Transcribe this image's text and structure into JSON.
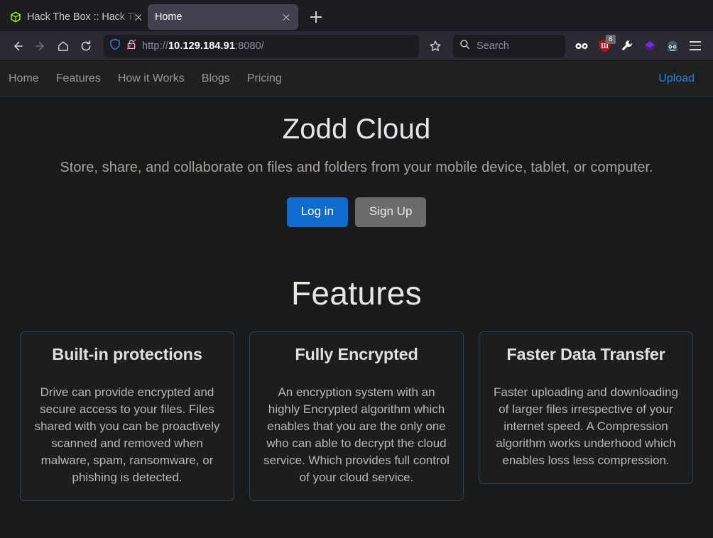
{
  "browser": {
    "tabs": [
      {
        "title": "Hack The Box :: Hack The Box",
        "favicon": "htb-cube-icon",
        "active": false
      },
      {
        "title": "Home",
        "favicon": "none",
        "active": true
      }
    ],
    "new_tab_label": "+",
    "toolbar": {
      "back_icon": "arrow-left-icon",
      "forward_icon": "arrow-right-icon",
      "home_icon": "home-icon",
      "reload_icon": "reload-icon",
      "shield_icon": "shield-icon",
      "lock_icon": "lock-crossed-icon",
      "bookmark_icon": "star-icon",
      "url_scheme": "http://",
      "url_host": "10.129.184.91",
      "url_port_path": ":8080/",
      "url_full": "http://10.129.184.91:8080/"
    },
    "search": {
      "placeholder": "Search",
      "icon": "search-icon"
    },
    "extensions": [
      {
        "name": "infinity-icon",
        "badge": ""
      },
      {
        "name": "ublock-shield-icon",
        "badge": "6"
      },
      {
        "name": "wrench-icon",
        "badge": ""
      },
      {
        "name": "purple-diamond-icon",
        "badge": ""
      },
      {
        "name": "hacker-avatar-icon",
        "badge": ""
      }
    ],
    "menu_icon": "hamburger-menu-icon"
  },
  "site": {
    "nav": {
      "links": [
        {
          "label": "Home"
        },
        {
          "label": "Features"
        },
        {
          "label": "How it Works"
        },
        {
          "label": "Blogs"
        },
        {
          "label": "Pricing"
        }
      ],
      "upload_label": "Upload",
      "upload_color": "#2d80d2"
    },
    "hero": {
      "title": "Zodd Cloud",
      "subtitle": "Store, share, and collaborate on files and folders from your mobile device, tablet, or computer.",
      "login_label": "Log in",
      "signup_label": "Sign Up",
      "login_color": "#0d6cce",
      "signup_color": "#6a6b6c"
    },
    "features": {
      "heading": "Features",
      "cards": [
        {
          "title": "Built-in protections",
          "body": "Drive can provide encrypted and secure access to your files. Files shared with you can be proactively scanned and removed when malware, spam, ransomware, or phishing is detected."
        },
        {
          "title": "Fully Encrypted",
          "body": "An encryption system with an highly Encrypted algorithm which enables that you are the only one who can able to decrypt the cloud service. Which provides full control of your cloud service."
        },
        {
          "title": "Faster Data Transfer",
          "body": "Faster uploading and downloading of larger files irrespective of your internet speed. A Compression algorithm works underhood which enables loss less compression."
        }
      ]
    }
  }
}
